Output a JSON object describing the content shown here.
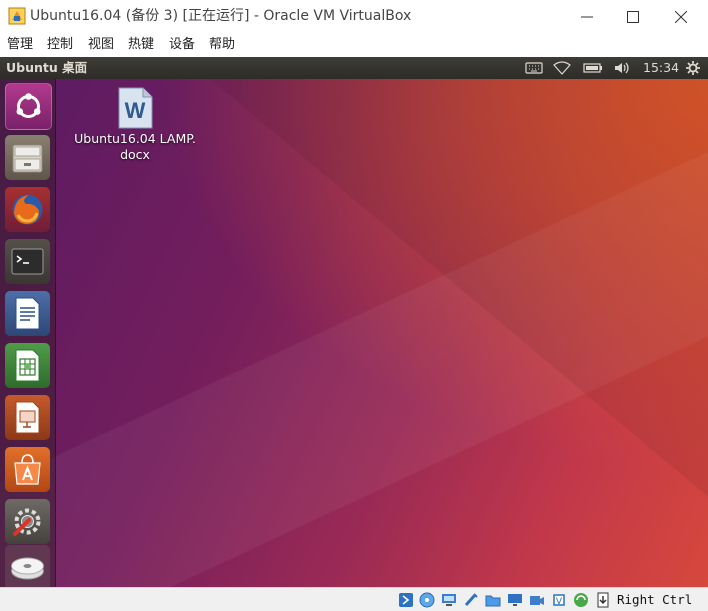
{
  "window": {
    "title": "Ubuntu16.04 (备份 3) [正在运行] - Oracle VM VirtualBox",
    "controls": [
      "minimize",
      "maximize",
      "close"
    ]
  },
  "menubar": {
    "items": [
      "管理",
      "控制",
      "视图",
      "热键",
      "设备",
      "帮助"
    ]
  },
  "ubuntu": {
    "topbar_title": "Ubuntu 桌面",
    "clock": "15:34",
    "tray_icons": [
      "keyboard-icon",
      "wifi-icon",
      "battery-icon",
      "volume-icon",
      "gear-icon"
    ]
  },
  "launcher": {
    "items": [
      {
        "name": "dash",
        "icon": "ubuntu-logo-icon"
      },
      {
        "name": "files",
        "icon": "file-cabinet-icon"
      },
      {
        "name": "firefox",
        "icon": "firefox-icon"
      },
      {
        "name": "terminal",
        "icon": "terminal-icon"
      },
      {
        "name": "writer",
        "icon": "document-icon"
      },
      {
        "name": "calc",
        "icon": "spreadsheet-icon"
      },
      {
        "name": "impress",
        "icon": "presentation-icon"
      },
      {
        "name": "software",
        "icon": "shopping-bag-icon"
      },
      {
        "name": "settings",
        "icon": "wrench-gear-icon"
      },
      {
        "name": "dvd",
        "icon": "disc-icon"
      }
    ]
  },
  "desktop": {
    "file_name": "Ubuntu16.04 LAMP.docx",
    "file_name_line1": "Ubuntu16.04 LAMP.",
    "file_name_line2": "docx",
    "file_icon_letter": "W"
  },
  "statusbar": {
    "host_key": "Right Ctrl",
    "icons": [
      "hdd-icon",
      "optical-icon",
      "network-icon",
      "usb-icon",
      "shared-folder-icon",
      "display-icon",
      "recording-icon",
      "cpu-icon",
      "mouse-integration-icon",
      "keyboard-capture-icon"
    ]
  },
  "colors": {
    "launcher_bg": "#371e2d",
    "ubuntu_orange": "#e95420",
    "topbar": "#3c3b37"
  }
}
